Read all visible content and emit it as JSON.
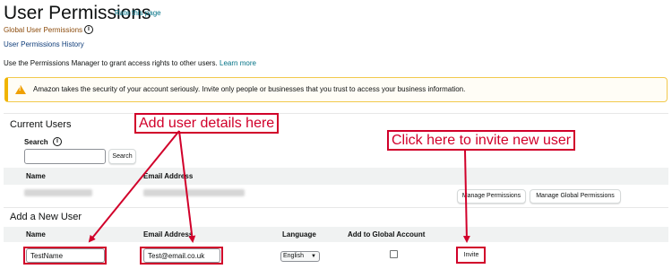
{
  "header": {
    "title": "User Permissions",
    "rate_link": "Rate this page",
    "global_link": "Global User Permissions",
    "info_glyph": "i",
    "history_link": "User Permissions History",
    "description": "Use the Permissions Manager to grant access rights to other users.",
    "learn_more": "Learn more"
  },
  "alert": {
    "text": "Amazon takes the security of your account seriously. Invite only people or businesses that you trust to access your business information.",
    "icon": "warning-icon"
  },
  "current_users": {
    "heading": "Current Users",
    "search_label": "Search",
    "search_value": "",
    "search_button": "Search",
    "columns": [
      "Name",
      "Email Address"
    ],
    "row_actions": [
      "Manage Permissions",
      "Manage Global Permissions"
    ]
  },
  "new_user": {
    "heading": "Add a New User",
    "columns": [
      "Name",
      "Email Address",
      "Language",
      "Add to Global Account"
    ],
    "name_value": "TestName",
    "email_value": "Test@email.co.uk",
    "language_value": "English",
    "global_checked": false,
    "invite_button": "Invite"
  },
  "annotations": {
    "callout_details": "Add user details here",
    "callout_invite": "Click here to invite new user",
    "color": "#d1002a"
  }
}
